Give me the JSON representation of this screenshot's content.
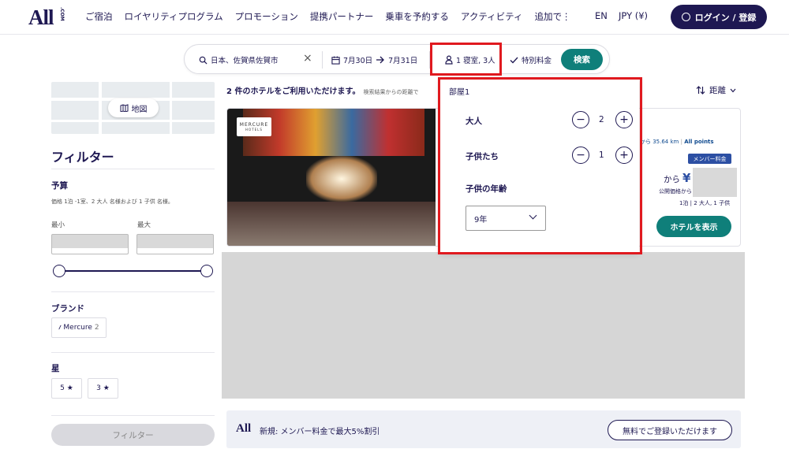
{
  "header": {
    "logo": "All",
    "logo_suffix": ".COM",
    "nav": [
      "ご宿泊",
      "ロイヤリティプログラム",
      "プロモーション",
      "提携パートナー",
      "乗車を予約する",
      "アクティビティ",
      "追加で⋮"
    ],
    "language": "EN",
    "currency": "JPY (¥)",
    "login_label": "ログイン / 登録"
  },
  "search": {
    "destination": "日本、佐賀県佐賀市",
    "checkin": "7月30日",
    "checkout": "7月31日",
    "rooms_guests": "1 寝室, 3人",
    "special_rate": "特別料金",
    "search_label": "検索"
  },
  "filters": {
    "map_label": "地図",
    "title": "フィルター",
    "budget_title": "予算",
    "budget_note": "価格 1泊 -1室、2 大人 名様および 1 子供 名様。",
    "min_label": "最小",
    "max_label": "最大",
    "brand_title": "ブランド",
    "brand_chip": "Mercure",
    "brand_count": "2",
    "stars_title": "星",
    "stars": [
      "5 ★",
      "3 ★"
    ],
    "apply_label": "フィルター"
  },
  "results": {
    "count_text": "2 件のホテルをご利用いただけます。",
    "sort_note": "検索結果からの距離で",
    "sort_label": "距離",
    "hotel": {
      "brand_badge": "MERCURE",
      "brand_badge_sub": "HOTELS",
      "distance": "から 35.64 km",
      "points": "All points",
      "member_badge": "メンバー料金",
      "from_label": "から",
      "currency_symbol": "¥",
      "public_price": "公開価格から",
      "per_night": "1泊 | 2 大人, 1 子供",
      "show_label": "ホテルを表示"
    }
  },
  "promo": {
    "logo": "All",
    "text": "新規: メンバー料金で最大5%割引",
    "cta": "無料でご登録いただけます"
  },
  "room_dropdown": {
    "room_label": "部屋1",
    "adults_label": "大人",
    "adults_value": "2",
    "children_label": "子供たち",
    "children_value": "1",
    "child_age_label": "子供の年齢",
    "child_age_value": "9年",
    "minus": "−",
    "plus": "+"
  },
  "colors": {
    "brand_navy": "#1e1852",
    "teal": "#0f7f7a",
    "highlight_red": "#e0191f",
    "member_blue": "#2c4fa3"
  }
}
